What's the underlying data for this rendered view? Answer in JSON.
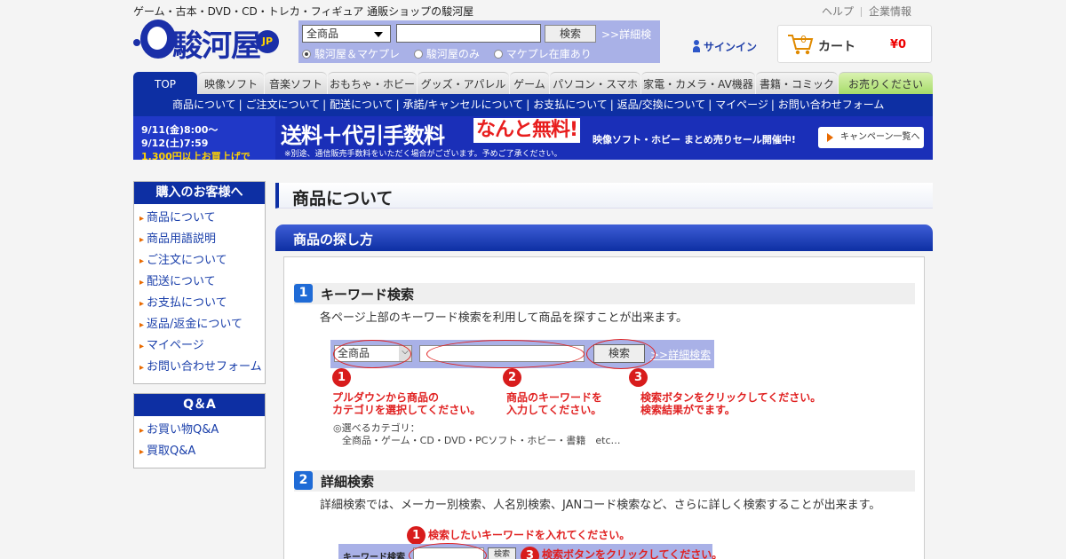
{
  "header": {
    "tagline": "ゲーム・古本・DVD・CD・トレカ・フィギュア 通販ショップの駿河屋",
    "help": "ヘルプ",
    "company": "企業情報",
    "logo_text": "駿河屋",
    "logo_badge": "JP"
  },
  "search": {
    "category_selected": "全商品",
    "keyword": "",
    "button": "検索",
    "advanced_link": ">>詳細検",
    "radio_options": [
      {
        "label": "駿河屋＆マケプレ",
        "checked": true
      },
      {
        "label": "駿河屋のみ",
        "checked": false
      },
      {
        "label": "マケプレ在庫あり",
        "checked": false
      }
    ]
  },
  "account": {
    "signin": "サインイン"
  },
  "cart": {
    "count": "0",
    "label": "カート",
    "total": "¥0"
  },
  "nav": {
    "tabs": [
      "TOP",
      "映像ソフト",
      "音楽ソフト",
      "おもちゃ・ホビー",
      "グッズ・アパレル",
      "ゲーム",
      "パソコン・スマホ",
      "家電・カメラ・AV機器",
      "書籍・コミック",
      "お売りください"
    ],
    "active": "TOP"
  },
  "subnav": [
    "商品について",
    "ご注文について",
    "配送について",
    "承諾/キャンセルについて",
    "お支払について",
    "返品/交換について",
    "マイページ",
    "お問い合わせフォーム"
  ],
  "banner": {
    "date_line1": "9/11(金)8:00〜9/12(土)7:59",
    "date_line2": "1,300円以上お買上げで",
    "headline": "送料＋代引手数料",
    "free": "なんと無料!",
    "sale": "映像ソフト・ホビー まとめ売りセール開催中!",
    "note": "※別途、通信販売手数料をいただく場合がございます。予めご了承ください。",
    "button": "キャンペーン一覧へ"
  },
  "sidebar": {
    "guide_title": "購入のお客様へ",
    "guide_items": [
      "商品について",
      "商品用語説明",
      "ご注文について",
      "配送について",
      "お支払について",
      "返品/返金について",
      "マイページ",
      "お問い合わせフォーム"
    ],
    "qa_title": "Q＆A",
    "qa_items": [
      "お買い物Q&A",
      "買取Q&A"
    ]
  },
  "content": {
    "page_title": "商品について",
    "section_title": "商品の探し方",
    "keyword": {
      "num": "1",
      "title": "キーワード検索",
      "desc": "各ページ上部のキーワード検索を利用して商品を探すことが出来ます。",
      "demo": {
        "category": "全商品",
        "button": "検索",
        "link": ">>詳細検索"
      },
      "callouts": [
        {
          "num": "1",
          "line1": "プルダウンから商品の",
          "line2": "カテゴリを選択してください。"
        },
        {
          "num": "2",
          "line1": "商品のキーワードを",
          "line2": "入力してください。"
        },
        {
          "num": "3",
          "line1": "検索ボタンをクリックしてください。",
          "line2": "検索結果がでます。"
        }
      ],
      "cats_title": "◎選べるカテゴリ：",
      "cats_list": "全商品・ゲーム・CD・DVD・PCソフト・ホビー・書籍　etc…"
    },
    "advanced": {
      "num": "2",
      "title": "詳細検索",
      "desc": "詳細検索では、メーカー別検索、人名別検索、JANコード検索など、さらに詳しく検索することが出来ます。",
      "demo": {
        "label": "キーワード検索",
        "button": "検索"
      },
      "callouts": [
        {
          "num": "1",
          "text": "検索したいキーワードを入れてください。"
        },
        {
          "num": "3",
          "text": "検索ボタンをクリックしてください。"
        }
      ]
    }
  },
  "colors": {
    "brand_blue": "#0d2fa3",
    "accent_red": "#e02020",
    "link_blue": "#1a3faa"
  }
}
